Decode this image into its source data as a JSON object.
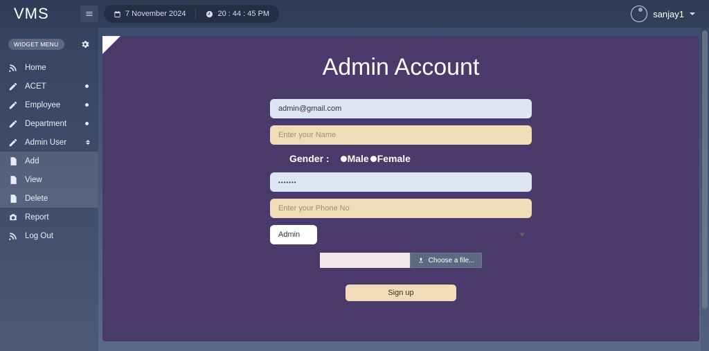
{
  "app": {
    "logo": "VMS"
  },
  "topbar": {
    "date": "7 November 2024",
    "time": "20 : 44 : 45 PM",
    "username": "sanjay1"
  },
  "sidebar": {
    "header": "WIDGET MENU",
    "items": [
      {
        "label": "Home"
      },
      {
        "label": "ACET"
      },
      {
        "label": "Employee"
      },
      {
        "label": "Department"
      },
      {
        "label": "Admin User"
      },
      {
        "label": "Add"
      },
      {
        "label": "View"
      },
      {
        "label": "Delete"
      },
      {
        "label": "Report"
      },
      {
        "label": "Log Out"
      }
    ]
  },
  "form": {
    "title": "Admin Account",
    "email_value": "admin@gmail.com",
    "name_placeholder": "Enter your Name",
    "gender_label": "Gender :",
    "gender_male": "Male",
    "gender_female": "Female",
    "password_value": "•••••••",
    "phone_placeholder": "Enter your Phone No",
    "role_selected": "Admin",
    "file_button": "Choose a file...",
    "submit": "Sign up"
  }
}
